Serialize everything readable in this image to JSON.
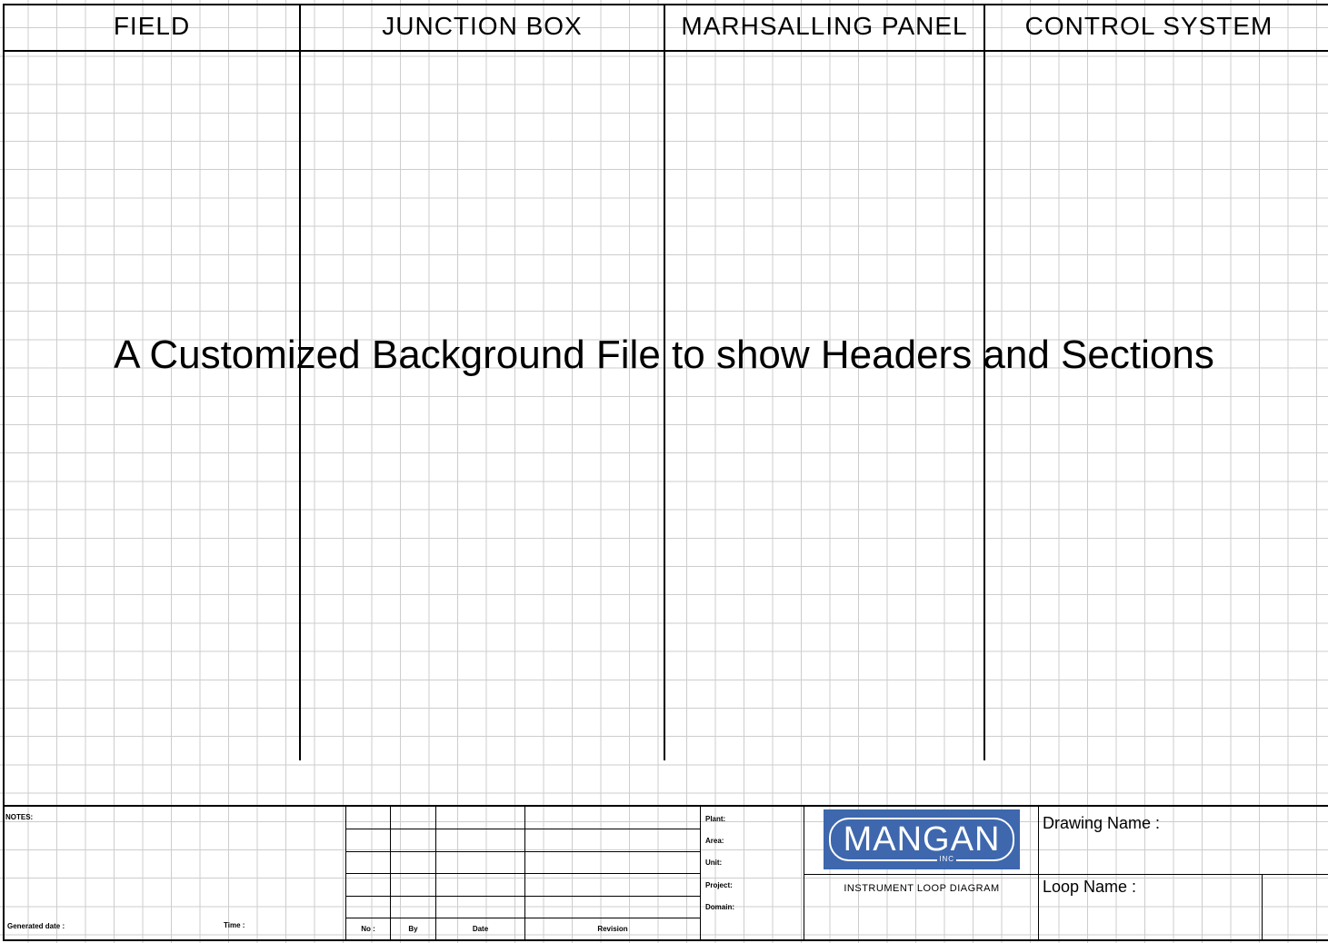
{
  "headers": {
    "field": "FIELD",
    "junction_box": "JUNCTION BOX",
    "marshalling_panel": "MARHSALLING PANEL",
    "control_system": "CONTROL SYSTEM"
  },
  "center_note": "A Customized Background File to show Headers and Sections",
  "title_block": {
    "notes_label": "NOTES:",
    "generated_date_label": "Generated date :",
    "time_label": "Time :",
    "revision_table": {
      "columns": [
        "No :",
        "By",
        "Date",
        "Revision"
      ]
    },
    "plant_label": "Plant:",
    "area_label": "Area:",
    "unit_label": "Unit:",
    "project_label": "Project:",
    "domain_label": "Domain:",
    "logo_text": "MANGAN",
    "logo_subtext": "INC",
    "logo_color": "#3e67ad",
    "diagram_type": "INSTRUMENT LOOP DIAGRAM",
    "drawing_name_label": "Drawing Name :",
    "loop_name_label": "Loop Name :"
  }
}
